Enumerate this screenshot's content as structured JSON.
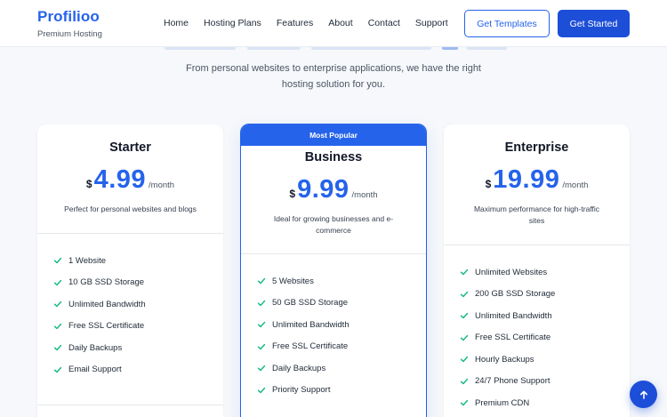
{
  "brand": {
    "name": "Profilioo",
    "tagline": "Premium Hosting"
  },
  "nav": {
    "items": [
      "Home",
      "Hosting Plans",
      "Features",
      "About",
      "Contact",
      "Support"
    ]
  },
  "header_buttons": {
    "templates": "Get Templates",
    "started": "Get Started"
  },
  "hero": {
    "subtitle": "From personal websites to enterprise applications, we have the right hosting solution for you."
  },
  "plans": [
    {
      "name": "Starter",
      "currency": "$",
      "price": "4.99",
      "period": "/month",
      "description": "Perfect for personal websites and blogs",
      "features": [
        "1 Website",
        "10 GB SSD Storage",
        "Unlimited Bandwidth",
        "Free SSL Certificate",
        "Daily Backups",
        "Email Support"
      ]
    },
    {
      "badge": "Most Popular",
      "name": "Business",
      "currency": "$",
      "price": "9.99",
      "period": "/month",
      "description": "Ideal for growing businesses and e-commerce",
      "features": [
        "5 Websites",
        "50 GB SSD Storage",
        "Unlimited Bandwidth",
        "Free SSL Certificate",
        "Daily Backups",
        "Priority Support"
      ]
    },
    {
      "name": "Enterprise",
      "currency": "$",
      "price": "19.99",
      "period": "/month",
      "description": "Maximum performance for high-traffic sites",
      "features": [
        "Unlimited Websites",
        "200 GB SSD Storage",
        "Unlimited Bandwidth",
        "Free SSL Certificate",
        "Hourly Backups",
        "24/7 Phone Support",
        "Premium CDN"
      ]
    }
  ],
  "colors": {
    "accent": "#2563eb",
    "check": "#10b981",
    "button": "#1d4ed8"
  },
  "icons": {
    "feature": "check-icon",
    "scroll": "arrow-up-icon"
  }
}
